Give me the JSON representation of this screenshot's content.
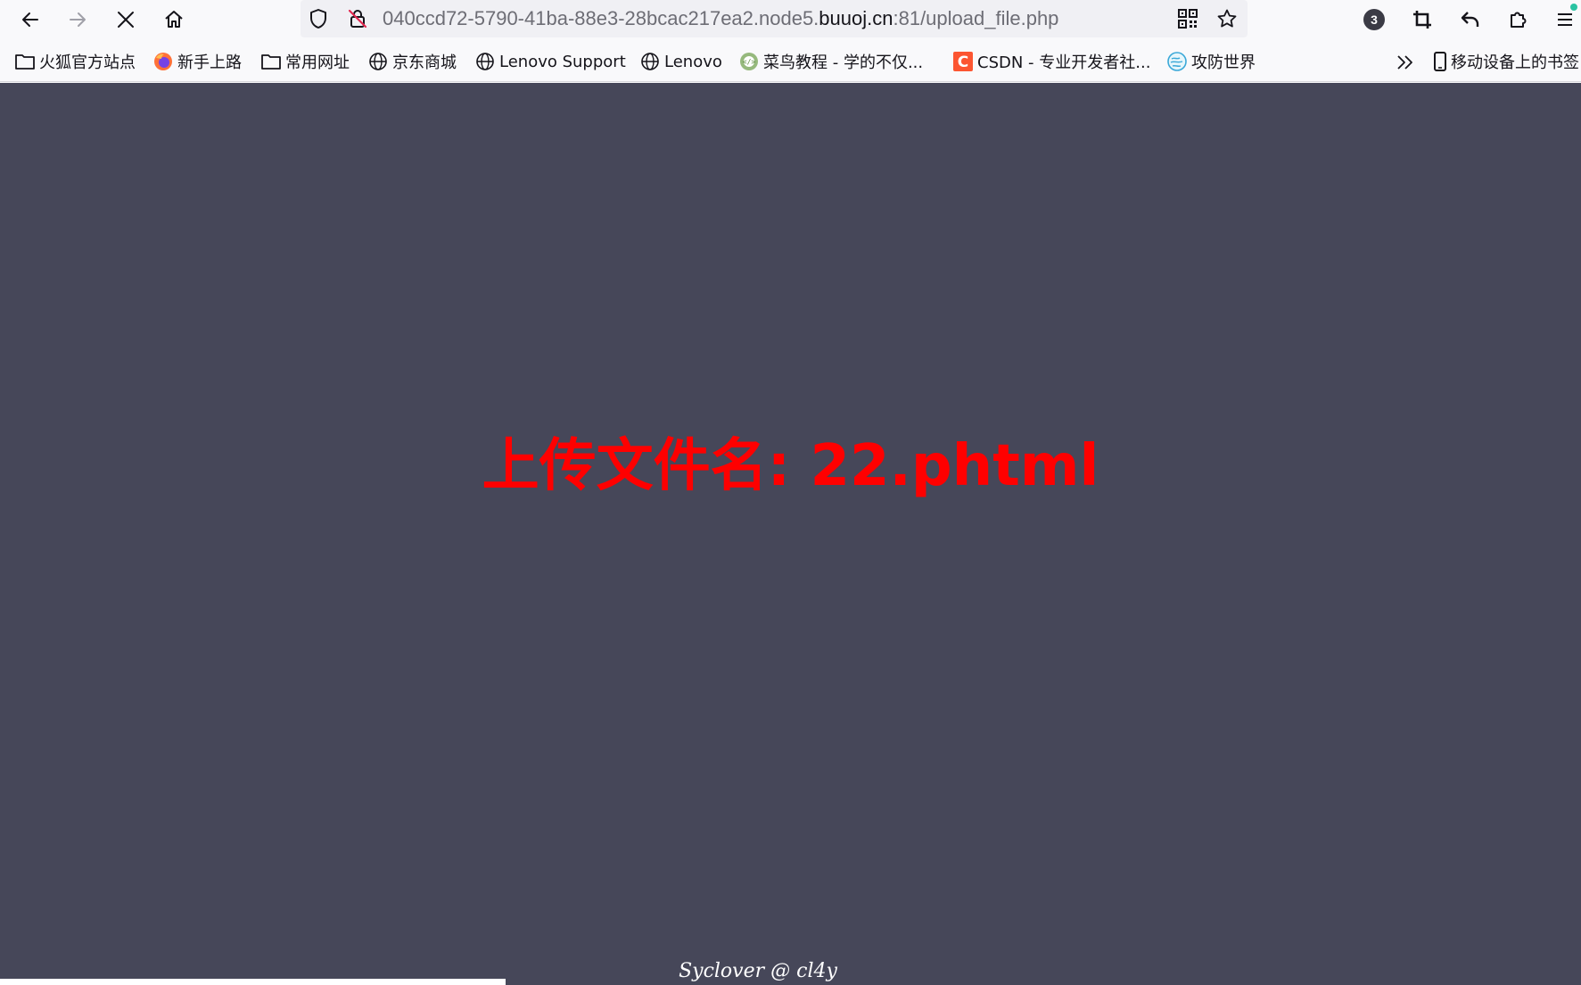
{
  "browser": {
    "url": {
      "prefix": "040ccd72-5790-41ba-88e3-28bcac217ea2.node5.",
      "domain": "buuoj.cn",
      "suffix": ":81/upload_file.php"
    },
    "extensions_badge": "3"
  },
  "bookmarks": [
    {
      "label": "火狐官方站点",
      "icon": "folder-icon"
    },
    {
      "label": "新手上路",
      "icon": "firefox-icon"
    },
    {
      "label": "常用网址",
      "icon": "folder-icon"
    },
    {
      "label": "京东商城",
      "icon": "globe-icon"
    },
    {
      "label": "Lenovo Support",
      "icon": "globe-icon"
    },
    {
      "label": "Lenovo",
      "icon": "globe-icon"
    },
    {
      "label": "菜鸟教程 - 学的不仅...",
      "icon": "runoob-icon"
    },
    {
      "label": "CSDN - 专业开发者社...",
      "icon": "csdn-icon"
    },
    {
      "label": "攻防世界",
      "icon": "adworld-icon"
    }
  ],
  "mobile_bookmarks": "移动设备上的书签",
  "page": {
    "heading": "上传文件名: 22.phtml",
    "footer": "Syclover @ cl4y"
  },
  "colors": {
    "page_background": "#464759",
    "heading": "#ff0000",
    "footer": "#ffffff"
  }
}
